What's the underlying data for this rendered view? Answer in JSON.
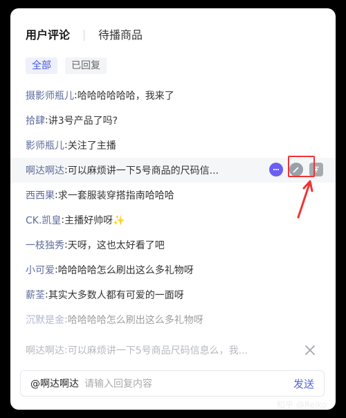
{
  "tabs": [
    {
      "label": "用户评论",
      "active": true
    },
    {
      "label": "待播商品",
      "active": false
    }
  ],
  "filters": [
    {
      "label": "全部",
      "active": true
    },
    {
      "label": "已回复",
      "active": false
    }
  ],
  "comments": [
    {
      "user": "摄影师瓶儿",
      "text": "哈哈哈哈哈哈，我来了"
    },
    {
      "user": "拾肆",
      "text": "讲3号产品了吗?"
    },
    {
      "user": "影师瓶儿",
      "text": "关注了主播"
    },
    {
      "user": "啊达啊达",
      "text": "可以麻烦讲一下5号商品的尺码信..."
    },
    {
      "user": "西西果",
      "text": "求一套服装穿搭指南哈哈哈"
    },
    {
      "user": "CK.凯皇",
      "text": "主播好帅呀✨"
    },
    {
      "user": "一枝独秀",
      "text": "天呀，这也太好看了吧"
    },
    {
      "user": "小可爱",
      "text": "哈哈哈哈怎么刷出这么多礼物呀"
    },
    {
      "user": "薪荃",
      "text": "其实大多数人都有可爱的一面呀"
    },
    {
      "user": "沉默是金",
      "text": "哈哈哈哈怎么刷出这么多礼物呀"
    }
  ],
  "reply_target": {
    "user": "啊达啊达",
    "text": "可以麻烦讲一下5号商品尺码信息么，我..."
  },
  "reply_box": {
    "mention": "@啊达啊达",
    "placeholder": "请输入回复内容",
    "send_label": "发送"
  },
  "watermark": "知乎 @Reiko",
  "colors": {
    "accent": "#5563d6",
    "username": "#5d6b9c",
    "highlight_box": "#e33333"
  }
}
